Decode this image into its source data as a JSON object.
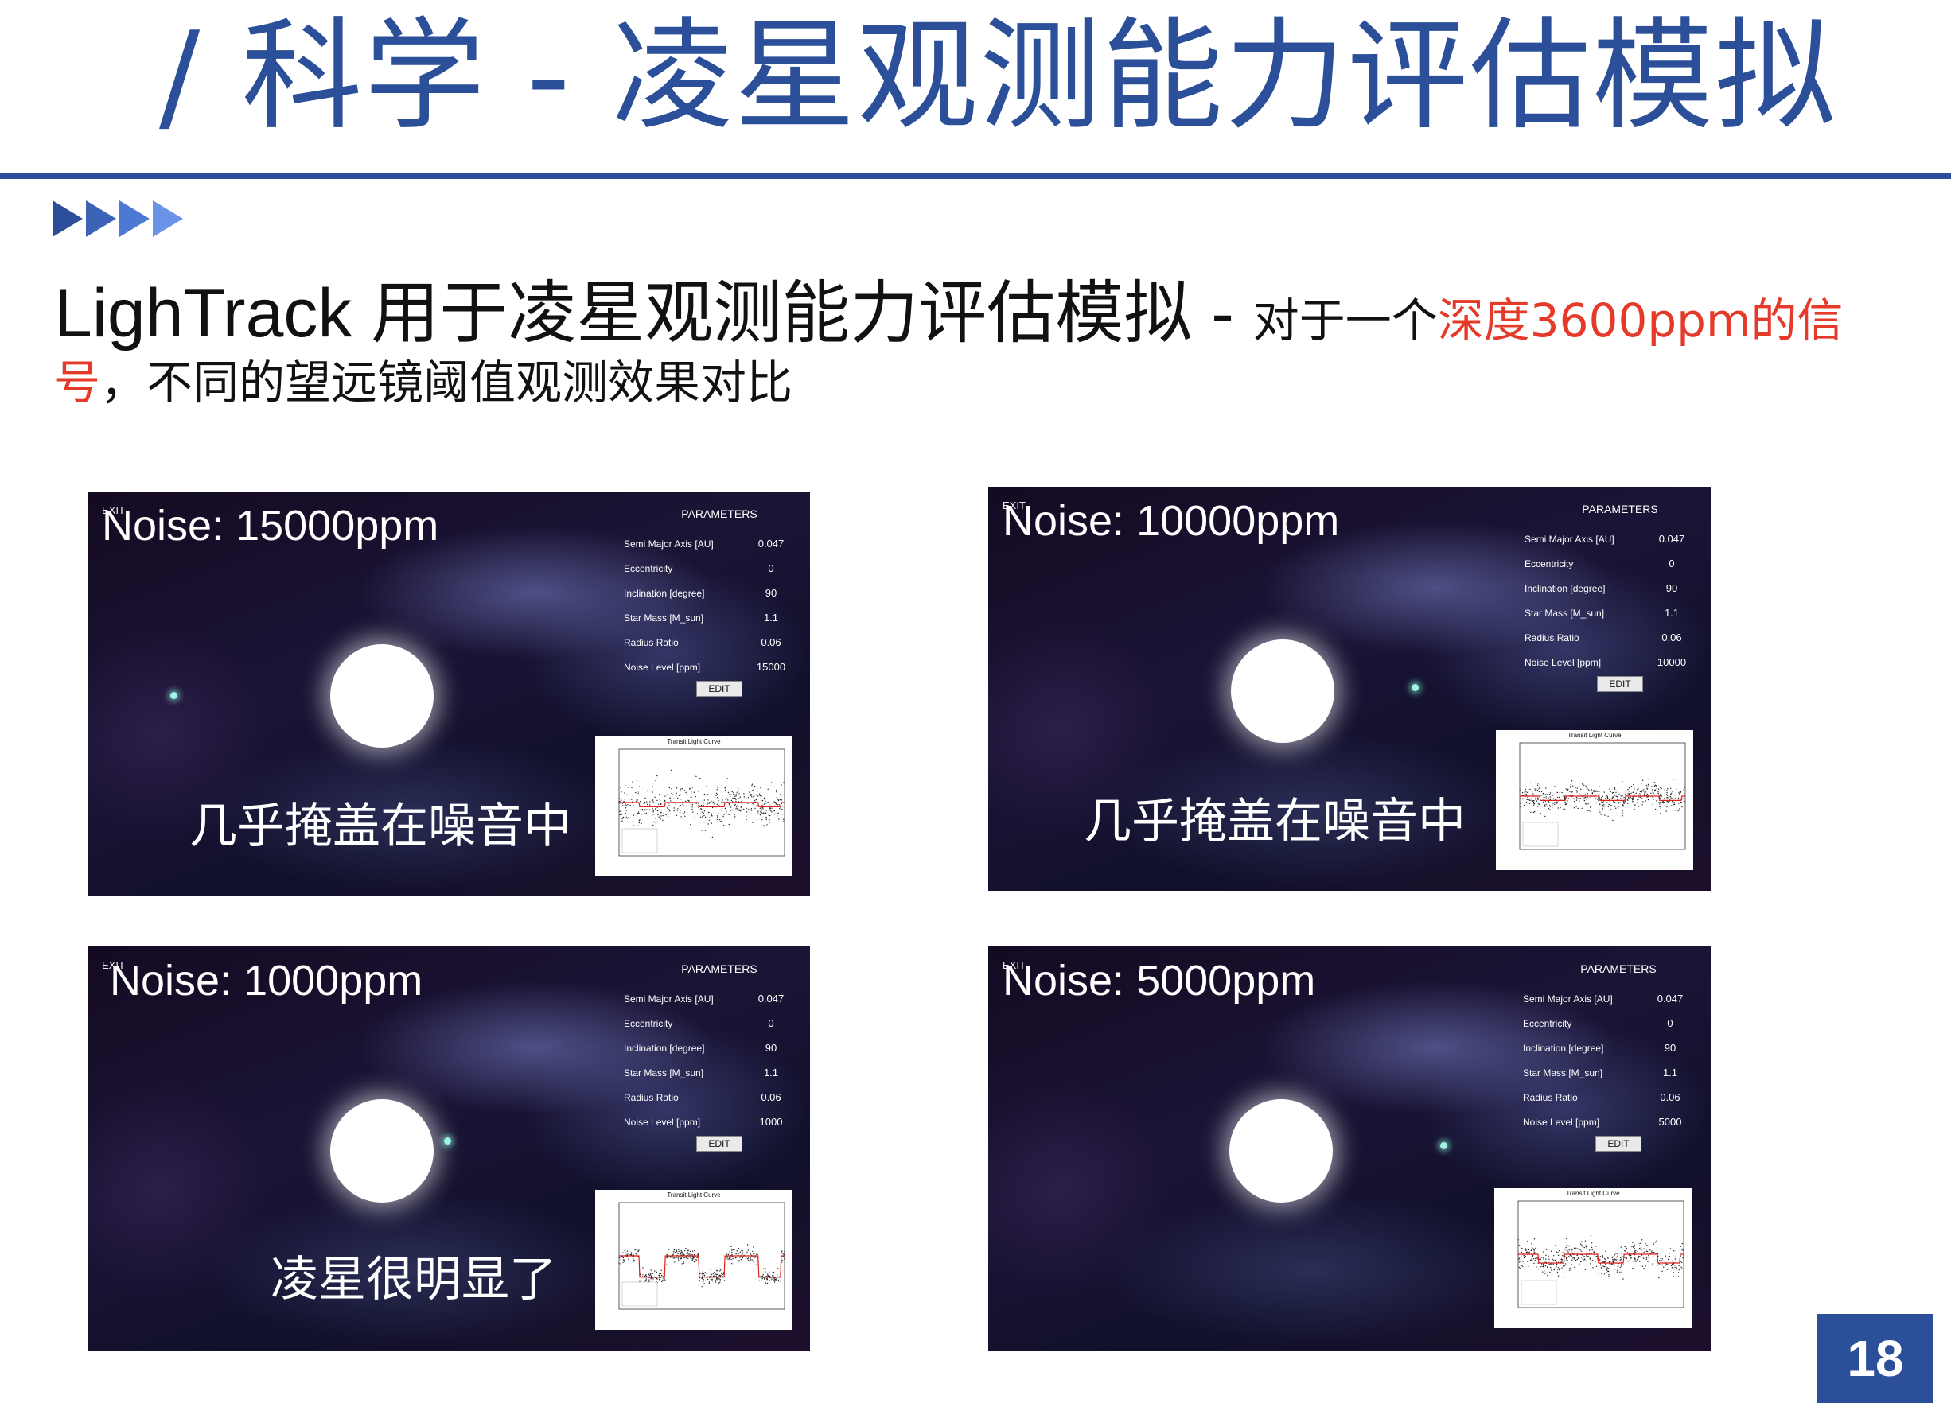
{
  "slide": {
    "title": "/ 科学 - 凌星观测能力评估模拟",
    "heading_main": "LighTrack 用于凌星观测能力评估模拟 - ",
    "heading_sub1": "对于一个",
    "heading_highlight1": "深度3600ppm的信",
    "heading_highlight2": "号",
    "heading_sub2": "，不同的望远镜阈值观测效果对比",
    "page_number": "18",
    "colors": {
      "brand": "#2b4f98",
      "highlight": "#e53a2a"
    }
  },
  "parameters_labels": {
    "header": "PARAMETERS",
    "semi_major": "Semi Major Axis [AU]",
    "eccentricity": "Eccentricity",
    "inclination": "Inclination [degree]",
    "star_mass": "Star Mass [M_sun]",
    "radius_ratio": "Radius Ratio",
    "noise_level": "Noise Level [ppm]",
    "edit": "EDIT",
    "exit": "EXIT",
    "plot_title": "Transit Light Curve"
  },
  "panels": [
    {
      "noise_label": "Noise: 15000ppm",
      "caption": "几乎掩盖在噪音中",
      "params": {
        "semi_major": "0.047",
        "eccentricity": "0",
        "inclination": "90",
        "star_mass": "1.1",
        "radius_ratio": "0.06",
        "noise_level": "15000"
      },
      "noise_ppm": 15000
    },
    {
      "noise_label": "Noise: 10000ppm",
      "caption": "几乎掩盖在噪音中",
      "params": {
        "semi_major": "0.047",
        "eccentricity": "0",
        "inclination": "90",
        "star_mass": "1.1",
        "radius_ratio": "0.06",
        "noise_level": "10000"
      },
      "noise_ppm": 10000
    },
    {
      "noise_label": "Noise: 1000ppm",
      "caption": "凌星很明显了",
      "params": {
        "semi_major": "0.047",
        "eccentricity": "0",
        "inclination": "90",
        "star_mass": "1.1",
        "radius_ratio": "0.06",
        "noise_level": "1000"
      },
      "noise_ppm": 1000
    },
    {
      "noise_label": "Noise: 5000ppm",
      "caption": "",
      "params": {
        "semi_major": "0.047",
        "eccentricity": "0",
        "inclination": "90",
        "star_mass": "1.1",
        "radius_ratio": "0.06",
        "noise_level": "5000"
      },
      "noise_ppm": 5000
    }
  ]
}
